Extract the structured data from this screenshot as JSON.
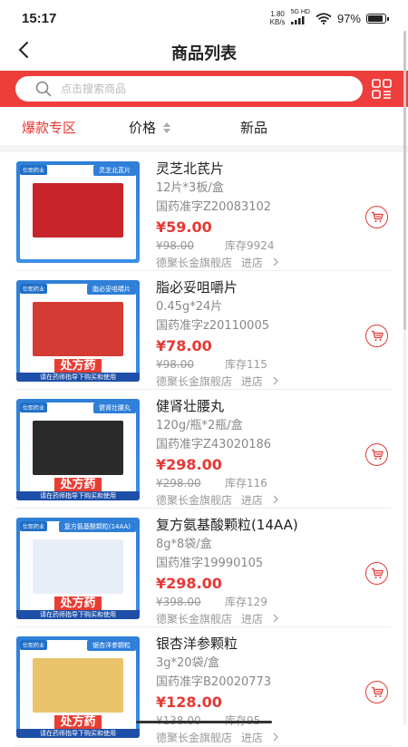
{
  "status": {
    "time": "15:17",
    "net_speed_value": "1.80",
    "net_speed_unit": "KB/s",
    "network": "5G HD",
    "battery_percent": "97%",
    "battery_level": 0.97
  },
  "nav": {
    "title": "商品列表",
    "back_icon": "chevron-left-icon"
  },
  "search": {
    "placeholder": "点击搜索商品",
    "search_icon": "search-icon",
    "scan_icon": "scan-icon"
  },
  "filters": {
    "hot": "爆款专区",
    "price": "价格",
    "new": "新品"
  },
  "colors": {
    "accent": "#e53935",
    "search_band": "#ee3e3c",
    "muted_text": "#888888"
  },
  "products": [
    {
      "name": "灵芝北芪片",
      "spec": "12片*3板/盒",
      "approval": "国药准字Z20083102",
      "price": "¥59.00",
      "original_price": "¥98.00",
      "stock": "库存9924",
      "shop": "德聚长金旗舰店",
      "enter": "进店",
      "thumb_badge": "仕熙药业",
      "thumb_tag": "灵芝北芪片",
      "thumb_color": "#c8252a",
      "rx": "",
      "rx_note": ""
    },
    {
      "name": "脂必妥咀嚼片",
      "spec": "0.45g*24片",
      "approval": "国药准字z20110005",
      "price": "¥78.00",
      "original_price": "¥98.00",
      "stock": "库存115",
      "shop": "德聚长金旗舰店",
      "enter": "进店",
      "thumb_badge": "仕熙药业",
      "thumb_tag": "脂必妥咀嚼片",
      "thumb_color": "#d23c34",
      "rx": "处方药",
      "rx_note": "请在药师指导下购买和使用"
    },
    {
      "name": "健肾壮腰丸",
      "spec": "120g/瓶*2瓶/盒",
      "approval": "国药准字Z43020186",
      "price": "¥298.00",
      "original_price": "¥298.00",
      "stock": "库存116",
      "shop": "德聚长金旗舰店",
      "enter": "进店",
      "thumb_badge": "仕熙药业",
      "thumb_tag": "健肾壮腰丸",
      "thumb_color": "#2b2b2b",
      "rx": "处方药",
      "rx_note": "请在药师指导下购买和使用"
    },
    {
      "name": "复方氨基酸颗粒(14AA)",
      "spec": "8g*8袋/盒",
      "approval": "国药准字19990105",
      "price": "¥298.00",
      "original_price": "¥398.00",
      "stock": "库存129",
      "shop": "德聚长金旗舰店",
      "enter": "进店",
      "thumb_badge": "仕熙药业",
      "thumb_tag": "复方氨基酸颗粒(14AA)",
      "thumb_color": "#e8eef8",
      "rx": "处方药",
      "rx_note": "请在药师指导下购买和使用"
    },
    {
      "name": "银杏洋参颗粒",
      "spec": "3g*20袋/盒",
      "approval": "国药准字B20020773",
      "price": "¥128.00",
      "original_price": "¥138.00",
      "stock": "库存95",
      "shop": "德聚长金旗舰店",
      "enter": "进店",
      "thumb_badge": "仕熙药业",
      "thumb_tag": "银杏洋参颗粒",
      "thumb_color": "#e9c46a",
      "rx": "处方药",
      "rx_note": "请在药师指导下购买和使用"
    }
  ]
}
